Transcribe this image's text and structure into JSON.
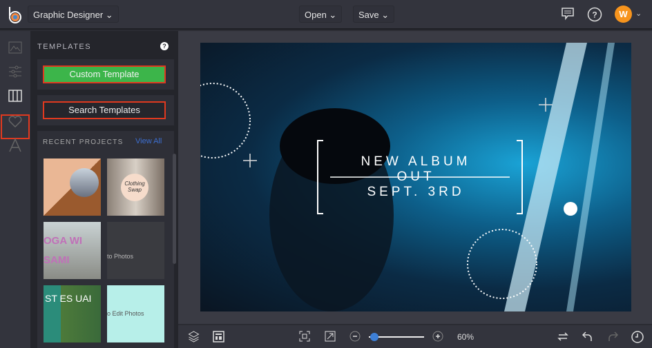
{
  "header": {
    "workspace": "Graphic Designer",
    "open": "Open",
    "save": "Save",
    "avatar_initial": "W"
  },
  "panel": {
    "title": "TEMPLATES",
    "help": "?",
    "custom_template": "Custom Template",
    "search_templates": "Search Templates",
    "recent_projects": "RECENT PROJECTS",
    "view_all": "View All",
    "thumbs": [
      {
        "text": ""
      },
      {
        "text": "Clothing Swap"
      },
      {
        "text": "OGA WI SAMI"
      },
      {
        "text": "to Photos"
      },
      {
        "text": "ST ES UAI"
      },
      {
        "text": "o Edit Photos"
      }
    ]
  },
  "canvas": {
    "line1": "NEW ALBUM",
    "line2": "OUT",
    "line3": "SEPT. 3RD"
  },
  "bottom": {
    "zoom": "60%",
    "zoom_fraction": 0.05
  },
  "colors": {
    "accent": "#3cb54a",
    "highlight": "#e0391f",
    "link": "#3d6fd1",
    "avatar": "#f7941d"
  }
}
